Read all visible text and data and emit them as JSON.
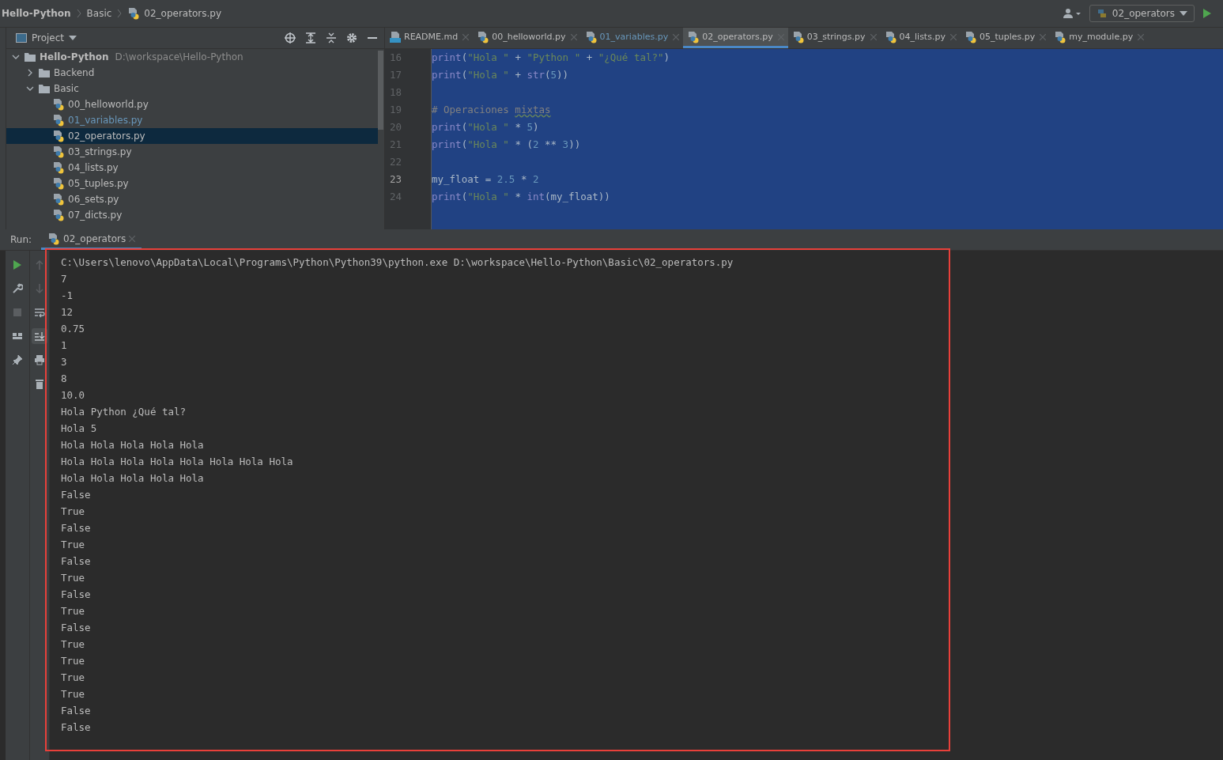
{
  "breadcrumbs": [
    "Hello-Python",
    "Basic",
    "02_operators.py"
  ],
  "run_config": {
    "label": "02_operators"
  },
  "project_panel": {
    "title": "Project",
    "tree": [
      {
        "label": "Hello-Python",
        "path": "D:\\workspace\\Hello-Python",
        "kind": "folder",
        "expanded": true,
        "selected": false,
        "children": [
          {
            "label": "Backend",
            "kind": "folder",
            "expanded": false,
            "selected": false
          },
          {
            "label": "Basic",
            "kind": "folder",
            "expanded": true,
            "selected": false,
            "children": [
              {
                "label": "00_helloworld.py",
                "kind": "python",
                "modified": false,
                "selected": false
              },
              {
                "label": "01_variables.py",
                "kind": "python",
                "modified": true,
                "selected": false
              },
              {
                "label": "02_operators.py",
                "kind": "python",
                "modified": false,
                "selected": true
              },
              {
                "label": "03_strings.py",
                "kind": "python",
                "modified": false,
                "selected": false
              },
              {
                "label": "04_lists.py",
                "kind": "python",
                "modified": false,
                "selected": false
              },
              {
                "label": "05_tuples.py",
                "kind": "python",
                "modified": false,
                "selected": false
              },
              {
                "label": "06_sets.py",
                "kind": "python",
                "modified": false,
                "selected": false
              },
              {
                "label": "07_dicts.py",
                "kind": "python",
                "modified": false,
                "selected": false
              }
            ]
          }
        ]
      }
    ]
  },
  "editor_tabs": [
    {
      "label": "README.md",
      "kind": "markdown",
      "modified": false,
      "selected": false
    },
    {
      "label": "00_helloworld.py",
      "kind": "python",
      "modified": false,
      "selected": false
    },
    {
      "label": "01_variables.py",
      "kind": "python",
      "modified": true,
      "selected": false
    },
    {
      "label": "02_operators.py",
      "kind": "python",
      "modified": false,
      "selected": true
    },
    {
      "label": "03_strings.py",
      "kind": "python",
      "modified": false,
      "selected": false
    },
    {
      "label": "04_lists.py",
      "kind": "python",
      "modified": false,
      "selected": false
    },
    {
      "label": "05_tuples.py",
      "kind": "python",
      "modified": false,
      "selected": false
    },
    {
      "label": "my_module.py",
      "kind": "python",
      "modified": false,
      "selected": false
    }
  ],
  "editor": {
    "lines": [
      {
        "number": "16",
        "current": false,
        "tokens": [
          {
            "kind": "fn",
            "text": "print"
          },
          {
            "kind": "plain",
            "text": "("
          },
          {
            "kind": "str",
            "text": "\"Hola \""
          },
          {
            "kind": "plain",
            "text": " + "
          },
          {
            "kind": "str",
            "text": "\"Python \""
          },
          {
            "kind": "plain",
            "text": " + "
          },
          {
            "kind": "str",
            "text": "\"¿Qué tal?\""
          },
          {
            "kind": "plain",
            "text": ")"
          }
        ]
      },
      {
        "number": "17",
        "current": false,
        "tokens": [
          {
            "kind": "fn",
            "text": "print"
          },
          {
            "kind": "plain",
            "text": "("
          },
          {
            "kind": "str",
            "text": "\"Hola \""
          },
          {
            "kind": "plain",
            "text": " + "
          },
          {
            "kind": "fn",
            "text": "str"
          },
          {
            "kind": "plain",
            "text": "("
          },
          {
            "kind": "num",
            "text": "5"
          },
          {
            "kind": "plain",
            "text": "))"
          }
        ]
      },
      {
        "number": "18",
        "current": false
      },
      {
        "number": "19",
        "current": false,
        "tokens": [
          {
            "kind": "comment",
            "text": "# Operaciones "
          },
          {
            "kind": "typo",
            "text": "mixtas"
          }
        ]
      },
      {
        "number": "20",
        "current": false,
        "tokens": [
          {
            "kind": "fn",
            "text": "print"
          },
          {
            "kind": "plain",
            "text": "("
          },
          {
            "kind": "str",
            "text": "\"Hola \""
          },
          {
            "kind": "plain",
            "text": " * "
          },
          {
            "kind": "num",
            "text": "5"
          },
          {
            "kind": "plain",
            "text": ")"
          }
        ]
      },
      {
        "number": "21",
        "current": false,
        "tokens": [
          {
            "kind": "fn",
            "text": "print"
          },
          {
            "kind": "plain",
            "text": "("
          },
          {
            "kind": "str",
            "text": "\"Hola \""
          },
          {
            "kind": "plain",
            "text": " * ("
          },
          {
            "kind": "num",
            "text": "2"
          },
          {
            "kind": "plain",
            "text": " ** "
          },
          {
            "kind": "num",
            "text": "3"
          },
          {
            "kind": "plain",
            "text": "))"
          }
        ]
      },
      {
        "number": "22",
        "current": false
      },
      {
        "number": "23",
        "current": true,
        "tokens": [
          {
            "kind": "plain",
            "text": "my_float = "
          },
          {
            "kind": "num",
            "text": "2.5"
          },
          {
            "kind": "plain",
            "text": " * "
          },
          {
            "kind": "num",
            "text": "2"
          }
        ]
      },
      {
        "number": "24",
        "current": false,
        "tokens": [
          {
            "kind": "fn",
            "text": "print"
          },
          {
            "kind": "plain",
            "text": "("
          },
          {
            "kind": "str",
            "text": "\"Hola \""
          },
          {
            "kind": "plain",
            "text": " * "
          },
          {
            "kind": "fn",
            "text": "int"
          },
          {
            "kind": "plain",
            "text": "(my_float))"
          }
        ]
      }
    ]
  },
  "run_panel": {
    "label": "Run:",
    "tab": {
      "label": "02_operators",
      "selected": true
    },
    "console": [
      "C:\\Users\\lenovo\\AppData\\Local\\Programs\\Python\\Python39\\python.exe D:\\workspace\\Hello-Python\\Basic\\02_operators.py",
      "7",
      "-1",
      "12",
      "0.75",
      "1",
      "3",
      "8",
      "10.0",
      "Hola Python ¿Qué tal?",
      "Hola 5",
      "Hola Hola Hola Hola Hola",
      "Hola Hola Hola Hola Hola Hola Hola Hola",
      "Hola Hola Hola Hola Hola",
      "False",
      "True",
      "False",
      "True",
      "False",
      "True",
      "False",
      "True",
      "False",
      "True",
      "True",
      "True",
      "True",
      "False",
      "False"
    ]
  }
}
